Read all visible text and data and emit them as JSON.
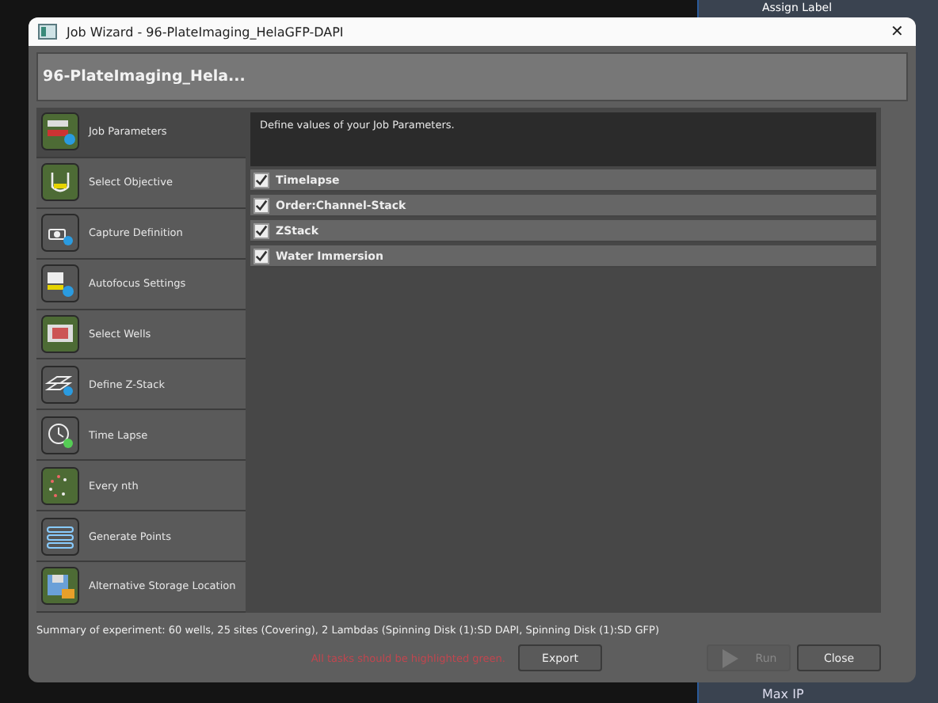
{
  "background_app": {
    "labels": [
      "Assign Label",
      "Max IP"
    ]
  },
  "window": {
    "title": "Job Wizard - 96-PlateImaging_HelaGFP-DAPI",
    "close": "✕"
  },
  "header": {
    "title": "96-PlateImaging_Hela..."
  },
  "sidebar": {
    "items": [
      {
        "label": "Job Parameters",
        "selected": true,
        "done": true
      },
      {
        "label": "Select Objective",
        "selected": false,
        "done": true
      },
      {
        "label": "Capture Definition",
        "selected": false,
        "done": false
      },
      {
        "label": "Autofocus Settings",
        "selected": false,
        "done": false
      },
      {
        "label": "Select Wells",
        "selected": false,
        "done": true
      },
      {
        "label": "Define Z-Stack",
        "selected": false,
        "done": false
      },
      {
        "label": "Time Lapse",
        "selected": false,
        "done": false
      },
      {
        "label": "Every nth",
        "selected": false,
        "done": true
      },
      {
        "label": "Generate Points",
        "selected": false,
        "done": false
      },
      {
        "label": "Alternative Storage Location",
        "selected": false,
        "done": true
      }
    ]
  },
  "content": {
    "description": "Define values of your Job Parameters.",
    "parameters": [
      {
        "label": "Timelapse",
        "checked": true
      },
      {
        "label": "Order:Channel-Stack",
        "checked": true
      },
      {
        "label": "ZStack",
        "checked": true
      },
      {
        "label": "Water Immersion",
        "checked": true
      }
    ]
  },
  "summary": "Summary of experiment: 60 wells, 25 sites (Covering), 2 Lambdas (Spinning Disk (1):SD DAPI, Spinning Disk (1):SD GFP)",
  "warning": "All tasks should be highlighted green.",
  "buttons": [
    {
      "label": "Export",
      "disabled": false
    },
    {
      "label": "Run",
      "disabled": true
    },
    {
      "label": "Close",
      "disabled": false
    }
  ]
}
